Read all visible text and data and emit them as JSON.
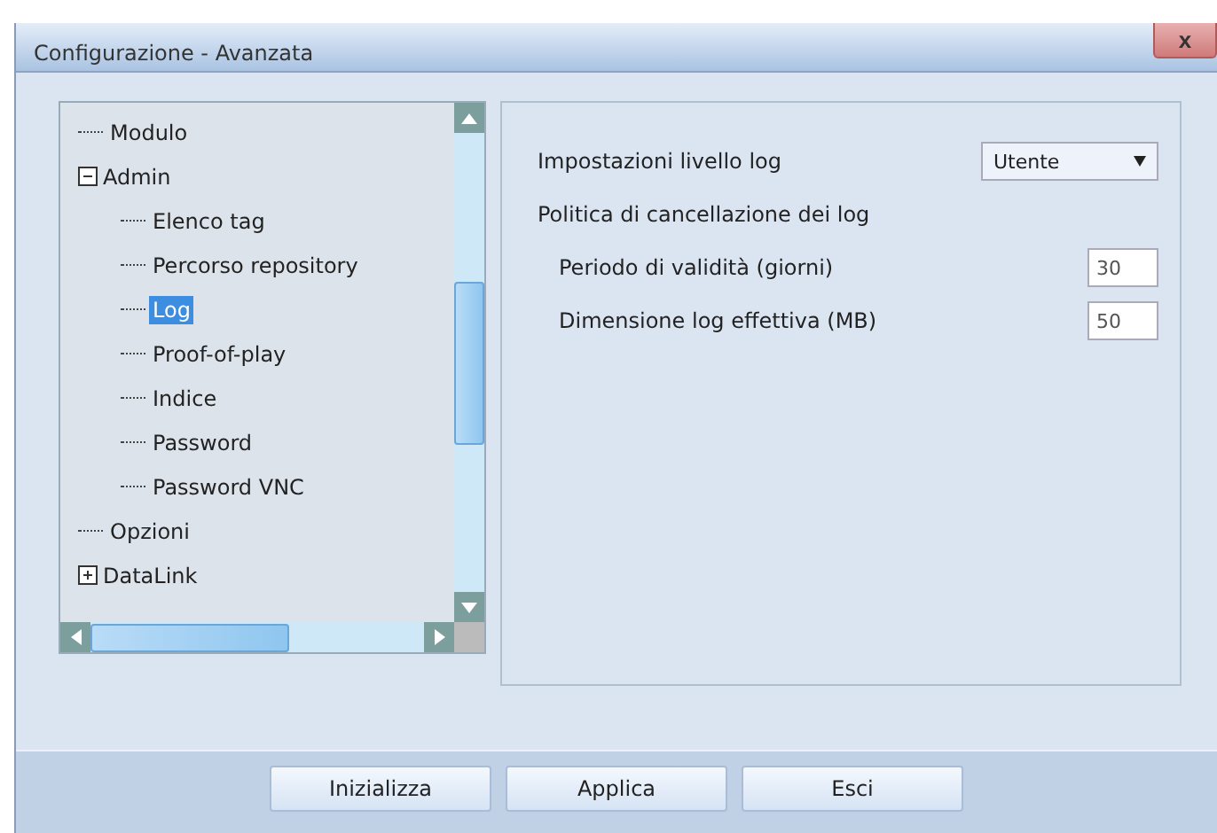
{
  "window": {
    "title": "Configurazione - Avanzata",
    "close": "x"
  },
  "tree": [
    {
      "label": "Modulo",
      "selected": false
    },
    {
      "label": "Admin",
      "selected": false,
      "expanded": true,
      "children": [
        {
          "label": "Elenco tag",
          "selected": false
        },
        {
          "label": "Percorso repository",
          "selected": false
        },
        {
          "label": "Log",
          "selected": true
        },
        {
          "label": "Proof-of-play",
          "selected": false
        },
        {
          "label": "Indice",
          "selected": false
        },
        {
          "label": "Password",
          "selected": false
        },
        {
          "label": "Password VNC",
          "selected": false
        }
      ]
    },
    {
      "label": "Opzioni",
      "selected": false
    },
    {
      "label": "DataLink",
      "selected": false,
      "expanded": false
    }
  ],
  "settings": [
    {
      "kind": "select",
      "label": "Impostazioni livello log",
      "value": "Utente"
    },
    {
      "kind": "heading",
      "label": "Politica di cancellazione dei log"
    },
    {
      "kind": "number",
      "label": "Periodo di validità (giorni)",
      "value": "30"
    },
    {
      "kind": "number",
      "label": "Dimensione log effettiva (MB)",
      "value": "50"
    }
  ],
  "buttons": [
    "Inizializza",
    "Applica",
    "Esci"
  ]
}
